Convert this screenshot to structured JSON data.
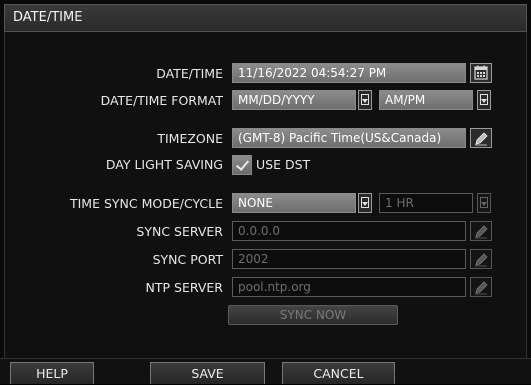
{
  "window": {
    "title": "DATE/TIME"
  },
  "form": {
    "datetime": {
      "label": "DATE/TIME",
      "value": "11/16/2022 04:54:27 PM",
      "icon": "calendar-icon"
    },
    "format": {
      "label": "DATE/TIME FORMAT",
      "date_value": "MM/DD/YYYY",
      "time_value": "AM/PM"
    },
    "timezone": {
      "label": "TIMEZONE",
      "value": "(GMT-8) Pacific Time(US&Canada)",
      "icon": "edit-icon"
    },
    "dst": {
      "label": "DAY LIGHT SAVING",
      "checkbox_label": "USE DST",
      "checked": true
    },
    "sync_mode": {
      "label": "TIME SYNC MODE/CYCLE",
      "mode_value": "NONE",
      "cycle_value": "1 HR"
    },
    "sync_server": {
      "label": "SYNC SERVER",
      "value": "0.0.0.0"
    },
    "sync_port": {
      "label": "SYNC PORT",
      "value": "2002"
    },
    "ntp_server": {
      "label": "NTP SERVER",
      "value": "pool.ntp.org"
    },
    "sync_now_label": "SYNC NOW"
  },
  "footer": {
    "help_label": "HELP",
    "save_label": "SAVE",
    "cancel_label": "CANCEL"
  },
  "colors": {
    "field_bg": "#7d7d7d",
    "disabled_bg": "#0c0c0c",
    "panel_bg": "#101010"
  }
}
